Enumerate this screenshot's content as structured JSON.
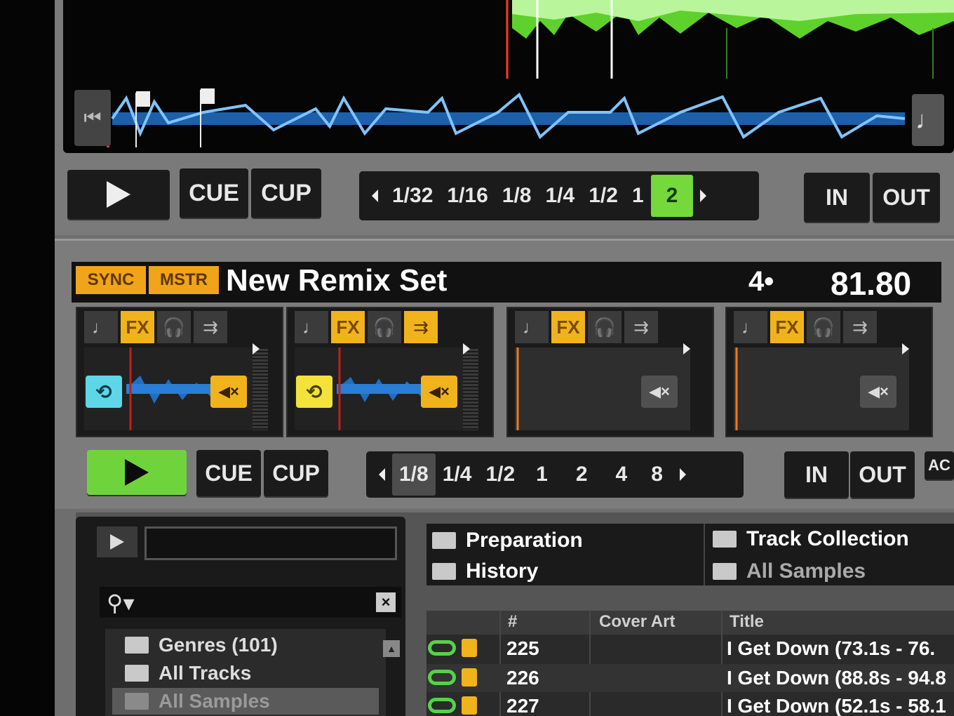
{
  "deck_a": {
    "skip_icon": "skip-to-start-icon",
    "note_icon": "music-note-icon",
    "transport": {
      "play_icon": "play-icon",
      "cue": "CUE",
      "cup": "CUP"
    },
    "loop_sizes": [
      "1/32",
      "1/16",
      "1/8",
      "1/4",
      "1/2",
      "1",
      "2"
    ],
    "active_loop": "2",
    "loop_in": "IN",
    "loop_out": "OUT"
  },
  "remix_deck": {
    "sync": "SYNC",
    "master": "MSTR",
    "title": "New Remix Set",
    "beat": "4•",
    "bpm": "81.80",
    "slots": [
      {
        "fx": "FX",
        "loop_color": "#5fd6e8",
        "mute_active": true,
        "has_wave": true
      },
      {
        "fx": "FX",
        "loop_color": "#f2e23a",
        "mute_active": true,
        "has_wave": true
      },
      {
        "fx": "FX",
        "loop_color": "",
        "mute_active": false,
        "has_wave": false
      },
      {
        "fx": "FX",
        "loop_color": "",
        "mute_active": false,
        "has_wave": false
      }
    ],
    "transport": {
      "play_icon": "play-icon",
      "cue": "CUE",
      "cup": "CUP"
    },
    "loop_sizes": [
      "1/8",
      "1/4",
      "1/2",
      "1",
      "2",
      "4",
      "8"
    ],
    "selected_loop": "1/8",
    "loop_in": "IN",
    "loop_out": "OUT",
    "extra_button": "AC"
  },
  "browser": {
    "favorites": [
      "Preparation",
      "Track Collection",
      "History",
      "All Samples"
    ],
    "tree": [
      "Genres (101)",
      "All Tracks",
      "All Samples"
    ],
    "columns": [
      "#",
      "Cover Art",
      "Title"
    ],
    "rows": [
      {
        "num": "225",
        "title": "I Get Down (73.1s - 76."
      },
      {
        "num": "226",
        "title": "I Get Down (88.8s - 94.8"
      },
      {
        "num": "227",
        "title": "I Get Down (52.1s - 58.1"
      }
    ],
    "colors": {
      "accent_green": "#75d83b",
      "accent_orange": "#f0a419"
    }
  }
}
